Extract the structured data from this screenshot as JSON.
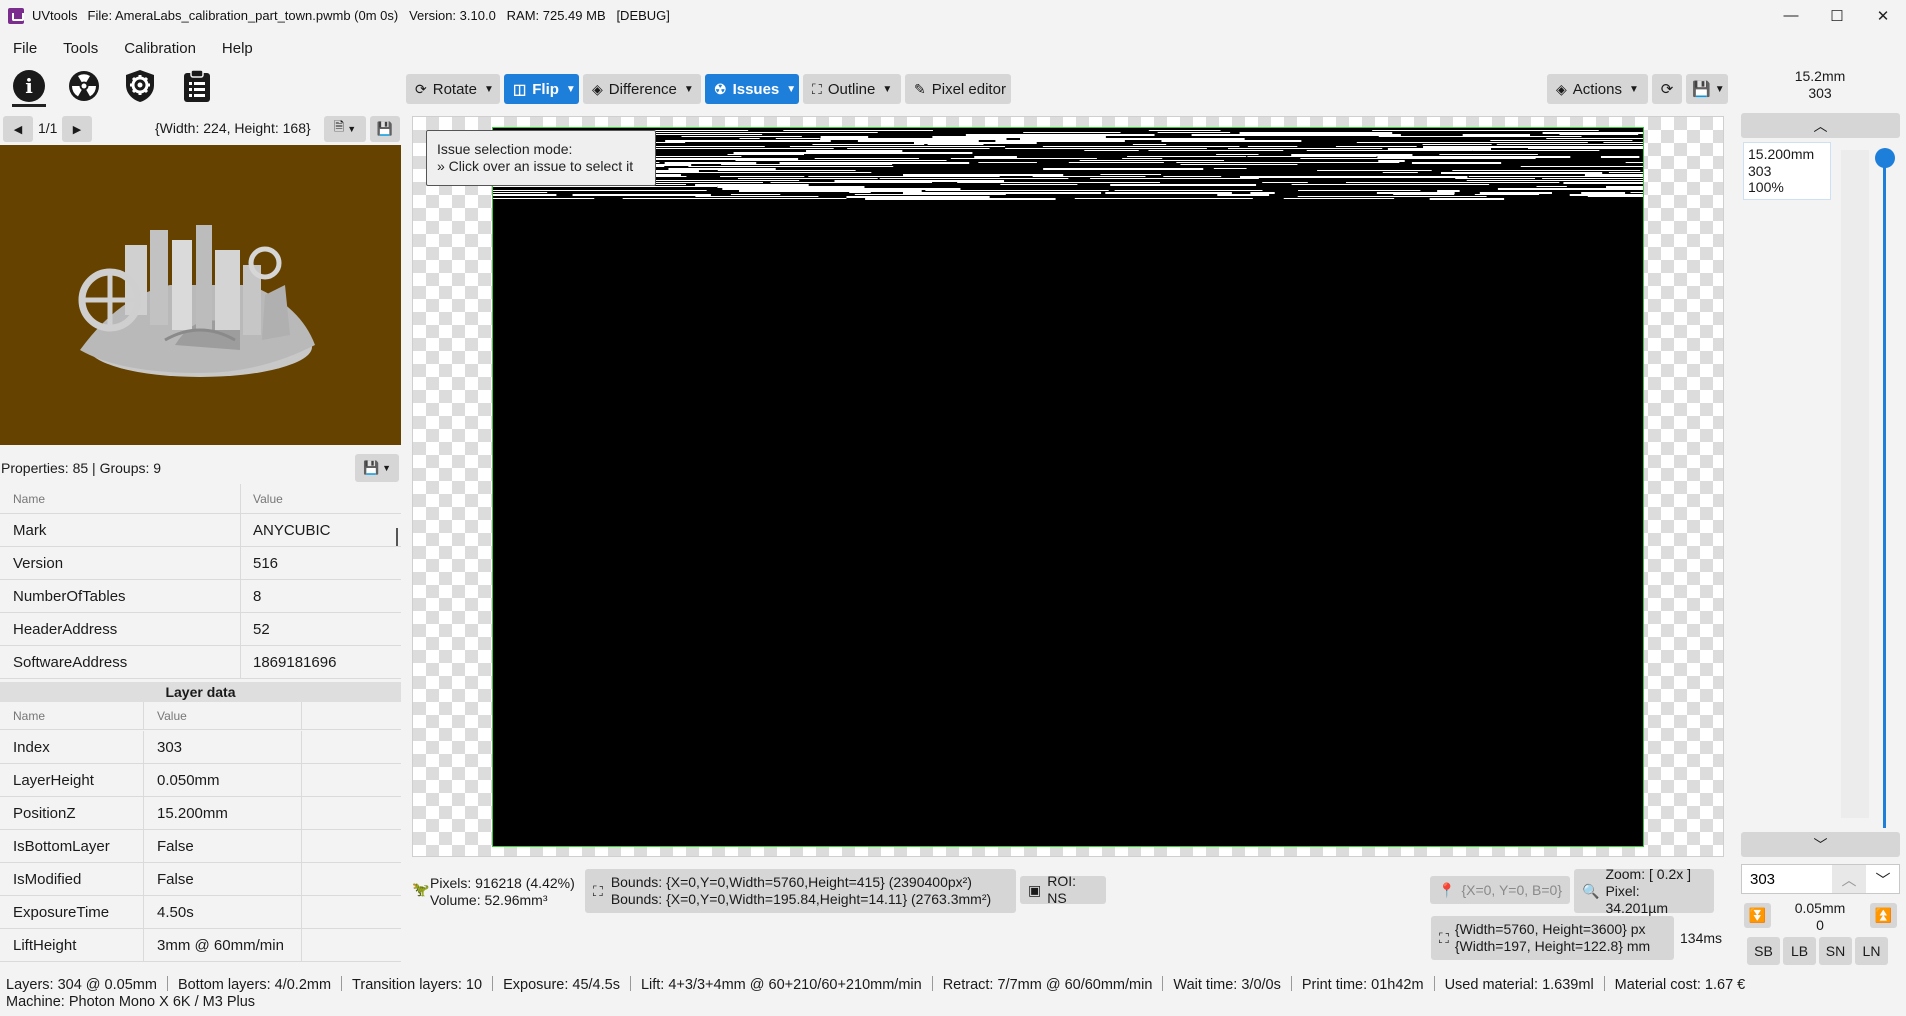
{
  "window": {
    "app_name": "UVtools",
    "title": "File: AmeraLabs_calibration_part_town.pwmb (0m 0s)   Version: 3.10.0   RAM: 725.49 MB   [DEBUG]",
    "minimize": "—",
    "maximize": "☐",
    "close": "✕"
  },
  "menu": [
    "File",
    "Tools",
    "Calibration",
    "Help"
  ],
  "left_tabs": [
    {
      "name": "information-icon",
      "glyph": "i"
    },
    {
      "name": "radiation-icon",
      "glyph": "☢"
    },
    {
      "name": "shield-gear-icon",
      "glyph": "⚙"
    },
    {
      "name": "clipboard-icon",
      "glyph": "☰"
    }
  ],
  "thumbnail": {
    "counter": "1/1",
    "dimensions": "{Width: 224, Height: 168}",
    "prev_glyph": "◀",
    "next_glyph": "▶"
  },
  "properties": {
    "summary": "Properties: 85 | Groups: 9",
    "col_name": "Name",
    "col_value": "Value",
    "rows": [
      {
        "name": "Mark",
        "value": "ANYCUBIC"
      },
      {
        "name": "Version",
        "value": "516"
      },
      {
        "name": "NumberOfTables",
        "value": "8"
      },
      {
        "name": "HeaderAddress",
        "value": "52"
      },
      {
        "name": "SoftwareAddress",
        "value": "1869181696"
      }
    ]
  },
  "layer_data": {
    "header": "Layer data",
    "col_name": "Name",
    "col_value": "Value",
    "rows": [
      {
        "name": "Index",
        "value": "303"
      },
      {
        "name": "LayerHeight",
        "value": "0.050mm"
      },
      {
        "name": "PositionZ",
        "value": "15.200mm"
      },
      {
        "name": "IsBottomLayer",
        "value": "False"
      },
      {
        "name": "IsModified",
        "value": "False"
      },
      {
        "name": "ExposureTime",
        "value": "4.50s"
      },
      {
        "name": "LiftHeight",
        "value": "3mm @ 60mm/min"
      }
    ]
  },
  "toolbar": {
    "rotate": "Rotate",
    "flip": "Flip",
    "difference": "Difference",
    "issues": "Issues",
    "outline": "Outline",
    "pixel_editor": "Pixel editor",
    "actions": "Actions"
  },
  "tooltip": {
    "line1": "Issue selection mode:",
    "line2": "» Click over an issue to select it"
  },
  "status": {
    "pixels": "Pixels: 916218 (4.42%)",
    "volume": "Volume: 52.96mm³",
    "bounds1": "Bounds: {X=0,Y=0,Width=5760,Height=415} (2390400px²)",
    "bounds2": "Bounds: {X=0,Y=0,Width=195.84,Height=14.11} (2763.3mm²)",
    "roi": "ROI: NS",
    "coords": "{X=0, Y=0, B=0}",
    "zoom": "Zoom: [ 0.2x ]",
    "pixel_size": "Pixel: 34.201µm",
    "resolution_px": "{Width=5760, Height=3600} px",
    "resolution_mm": "{Width=197, Height=122.8} mm",
    "render_time": "134ms"
  },
  "layer_nav": {
    "top_height": "15.2mm",
    "top_index": "303",
    "tip_height": "15.200mm",
    "tip_index": "303",
    "tip_percent": "100%",
    "slider_fraction": 1.0,
    "layer_input": "303",
    "bottom_height": "0.05mm",
    "bottom_index": "0",
    "buttons": [
      "SB",
      "LB",
      "SN",
      "LN"
    ]
  },
  "bottom_status": {
    "items": [
      "Layers: 304 @ 0.05mm",
      "Bottom layers: 4/0.2mm",
      "Transition layers: 10",
      "Exposure: 45/4.5s",
      "Lift: 4+3/3+4mm @ 60+210/60+210mm/min",
      "Retract: 7/7mm @ 60/60mm/min",
      "Wait time: 3/0/0s",
      "Print time: 01h42m",
      "Used material: 1.639ml",
      "Material cost: 1.67 €"
    ],
    "machine": "Machine: Photon Mono X 6K / M3 Plus"
  },
  "colors": {
    "accent": "#1e7fdb",
    "preview_bg": "#654200",
    "layer_bg": "#000000",
    "bounds_outline": "#39c93a"
  }
}
